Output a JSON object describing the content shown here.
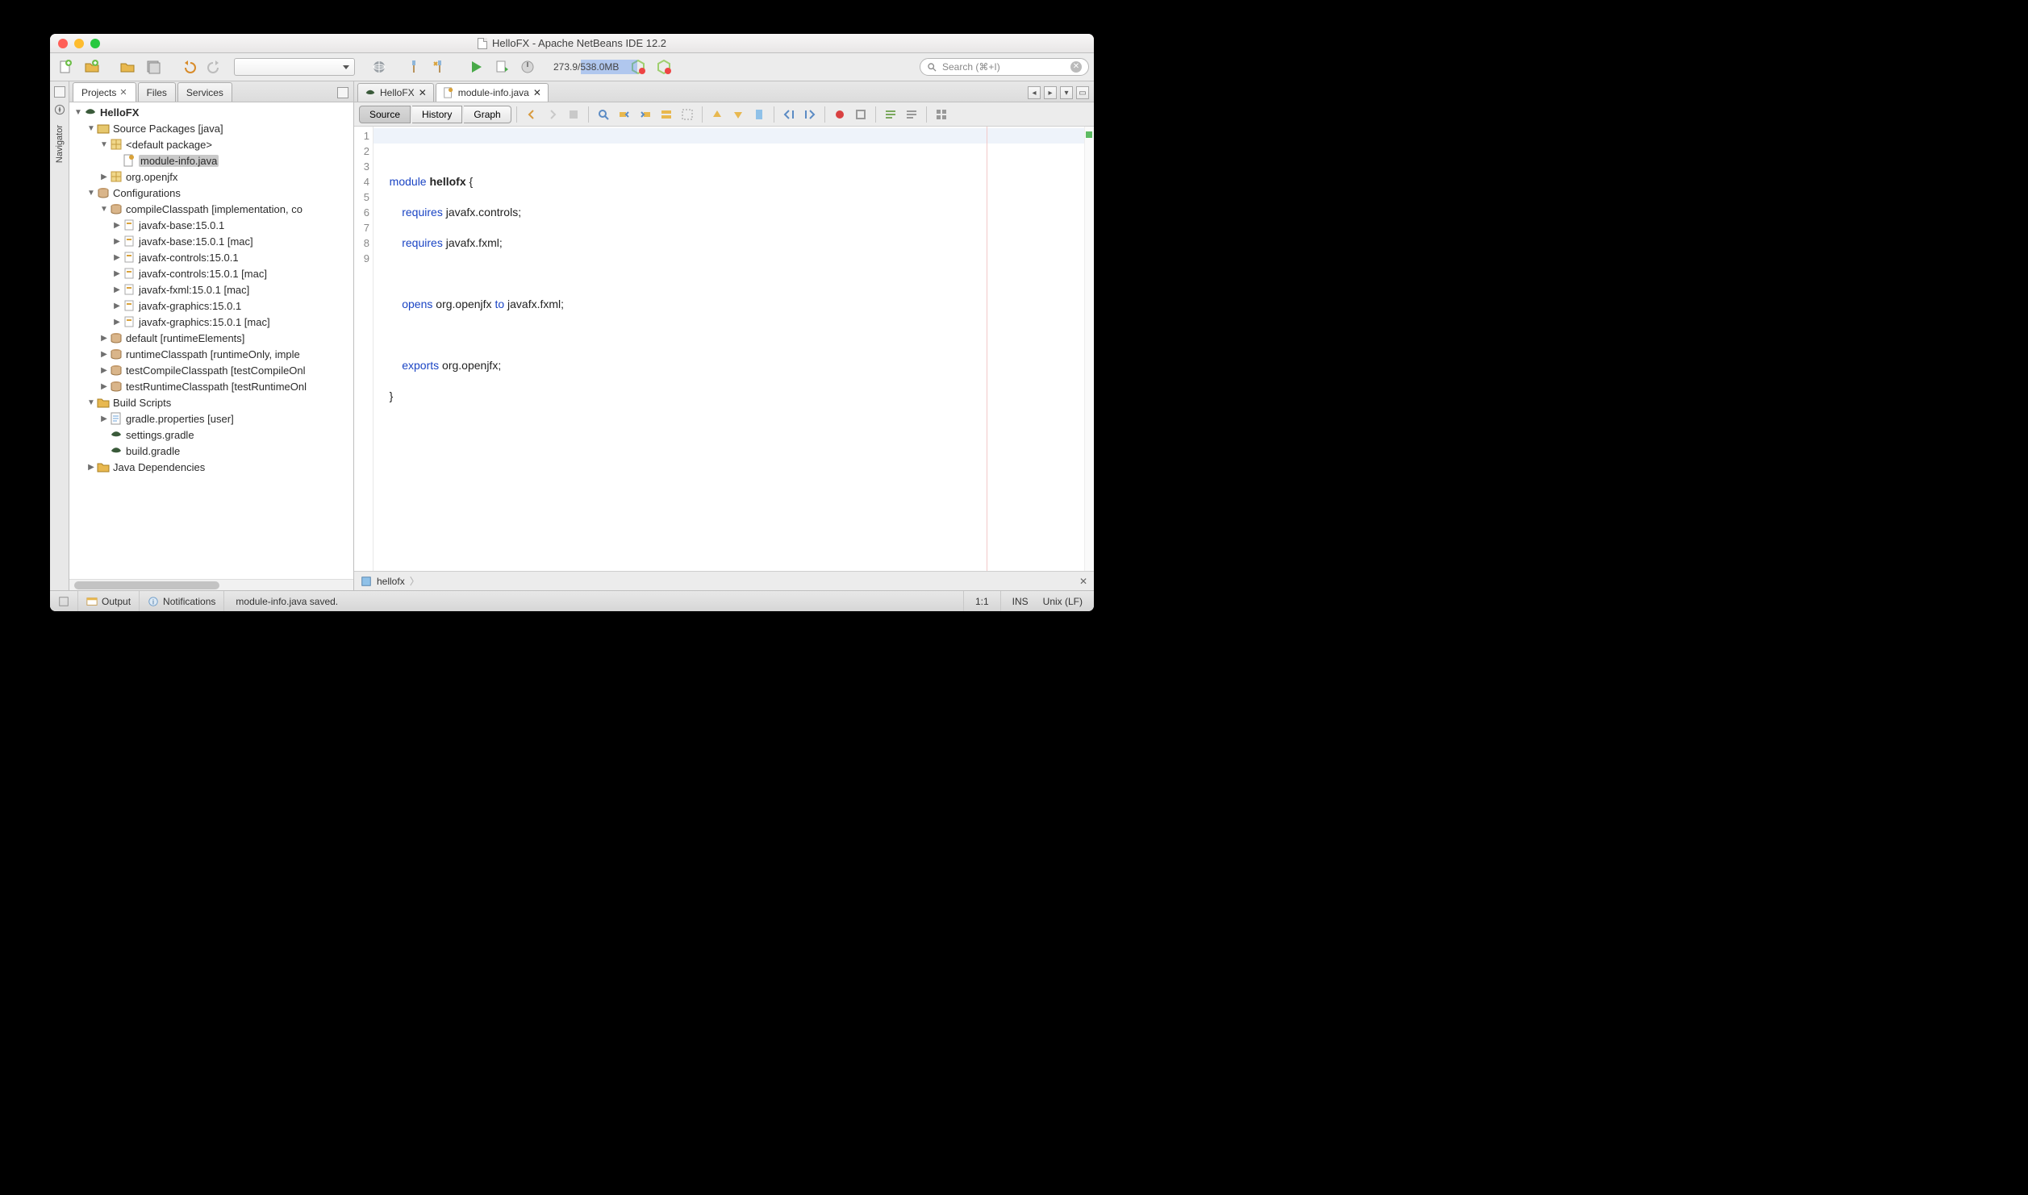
{
  "title": "HelloFX - Apache NetBeans IDE 12.2",
  "toolbar": {
    "memory": "273.9/538.0MB",
    "search_placeholder": "Search (⌘+I)"
  },
  "navigator_label": "Navigator",
  "left_tabs": {
    "projects": "Projects",
    "files": "Files",
    "services": "Services"
  },
  "tree": {
    "project": "HelloFX",
    "source_packages": "Source Packages [java]",
    "default_package": "<default package>",
    "module_info": "module-info.java",
    "org_openjfx": "org.openjfx",
    "configurations": "Configurations",
    "compile_classpath": "compileClasspath [implementation, co",
    "deps": [
      "javafx-base:15.0.1",
      "javafx-base:15.0.1 [mac]",
      "javafx-controls:15.0.1",
      "javafx-controls:15.0.1 [mac]",
      "javafx-fxml:15.0.1 [mac]",
      "javafx-graphics:15.0.1",
      "javafx-graphics:15.0.1 [mac]"
    ],
    "cfg_default": "default [runtimeElements]",
    "cfg_runtime": "runtimeClasspath [runtimeOnly, imple",
    "cfg_testcompile": "testCompileClasspath [testCompileOnl",
    "cfg_testruntime": "testRuntimeClasspath [testRuntimeOnl",
    "build_scripts": "Build Scripts",
    "gradle_props": "gradle.properties [user]",
    "settings_gradle": "settings.gradle",
    "build_gradle": "build.gradle",
    "java_deps": "Java Dependencies"
  },
  "editor_tabs": {
    "hellofx": "HelloFX",
    "module_info": "module-info.java"
  },
  "editor_toolbar": {
    "source": "Source",
    "history": "History",
    "graph": "Graph"
  },
  "code": {
    "l1a": "module ",
    "l1b": "hellofx",
    "l1c": " {",
    "l2a": "requires",
    "l2b": " javafx.controls;",
    "l3a": "requires",
    "l3b": " javafx.fxml;",
    "l5a": "opens",
    "l5b": " org.openjfx ",
    "l5c": "to",
    "l5d": " javafx.fxml;",
    "l7a": "exports",
    "l7b": " org.openjfx;",
    "l8": "}"
  },
  "breadcrumb": "hellofx",
  "status": {
    "output": "Output",
    "notifications": "Notifications",
    "message": "module-info.java saved.",
    "cursor": "1:1",
    "ins": "INS",
    "encoding": "Unix (LF)"
  }
}
